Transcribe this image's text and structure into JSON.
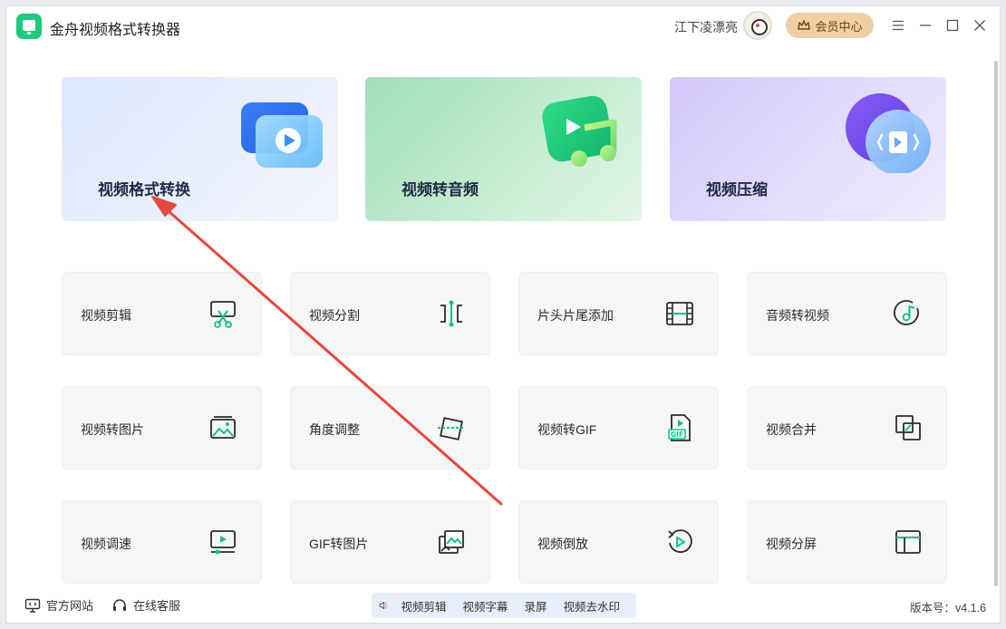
{
  "app": {
    "title": "金舟视频格式转换器"
  },
  "header": {
    "user_name": "江下凌漂亮",
    "vip_label": "会员中心"
  },
  "feature_cards": [
    {
      "label": "视频格式转换"
    },
    {
      "label": "视频转音频"
    },
    {
      "label": "视频压缩"
    }
  ],
  "tools": [
    {
      "label": "视频剪辑",
      "icon": "scissors-icon"
    },
    {
      "label": "视频分割",
      "icon": "split-icon"
    },
    {
      "label": "片头片尾添加",
      "icon": "film-strip-icon"
    },
    {
      "label": "音频转视频",
      "icon": "music-note-icon"
    },
    {
      "label": "视频转图片",
      "icon": "image-icon"
    },
    {
      "label": "角度调整",
      "icon": "rotate-frame-icon"
    },
    {
      "label": "视频转GIF",
      "icon": "gif-file-icon"
    },
    {
      "label": "视频合并",
      "icon": "merge-squares-icon"
    },
    {
      "label": "视频调速",
      "icon": "speed-screen-icon"
    },
    {
      "label": "GIF转图片",
      "icon": "gif-image-icon"
    },
    {
      "label": "视频倒放",
      "icon": "reverse-play-icon"
    },
    {
      "label": "视频分屏",
      "icon": "split-screen-icon"
    }
  ],
  "footer": {
    "website_label": "官方网站",
    "service_label": "在线客服",
    "marquee": [
      "视频剪辑",
      "视频字幕",
      "录屏",
      "视频去水印"
    ],
    "version": "版本号：v4.1.6"
  },
  "colors": {
    "accent_green": "#1fc97e",
    "arrow_red": "#e8473b",
    "vip_gold": "#f0cfa3"
  }
}
